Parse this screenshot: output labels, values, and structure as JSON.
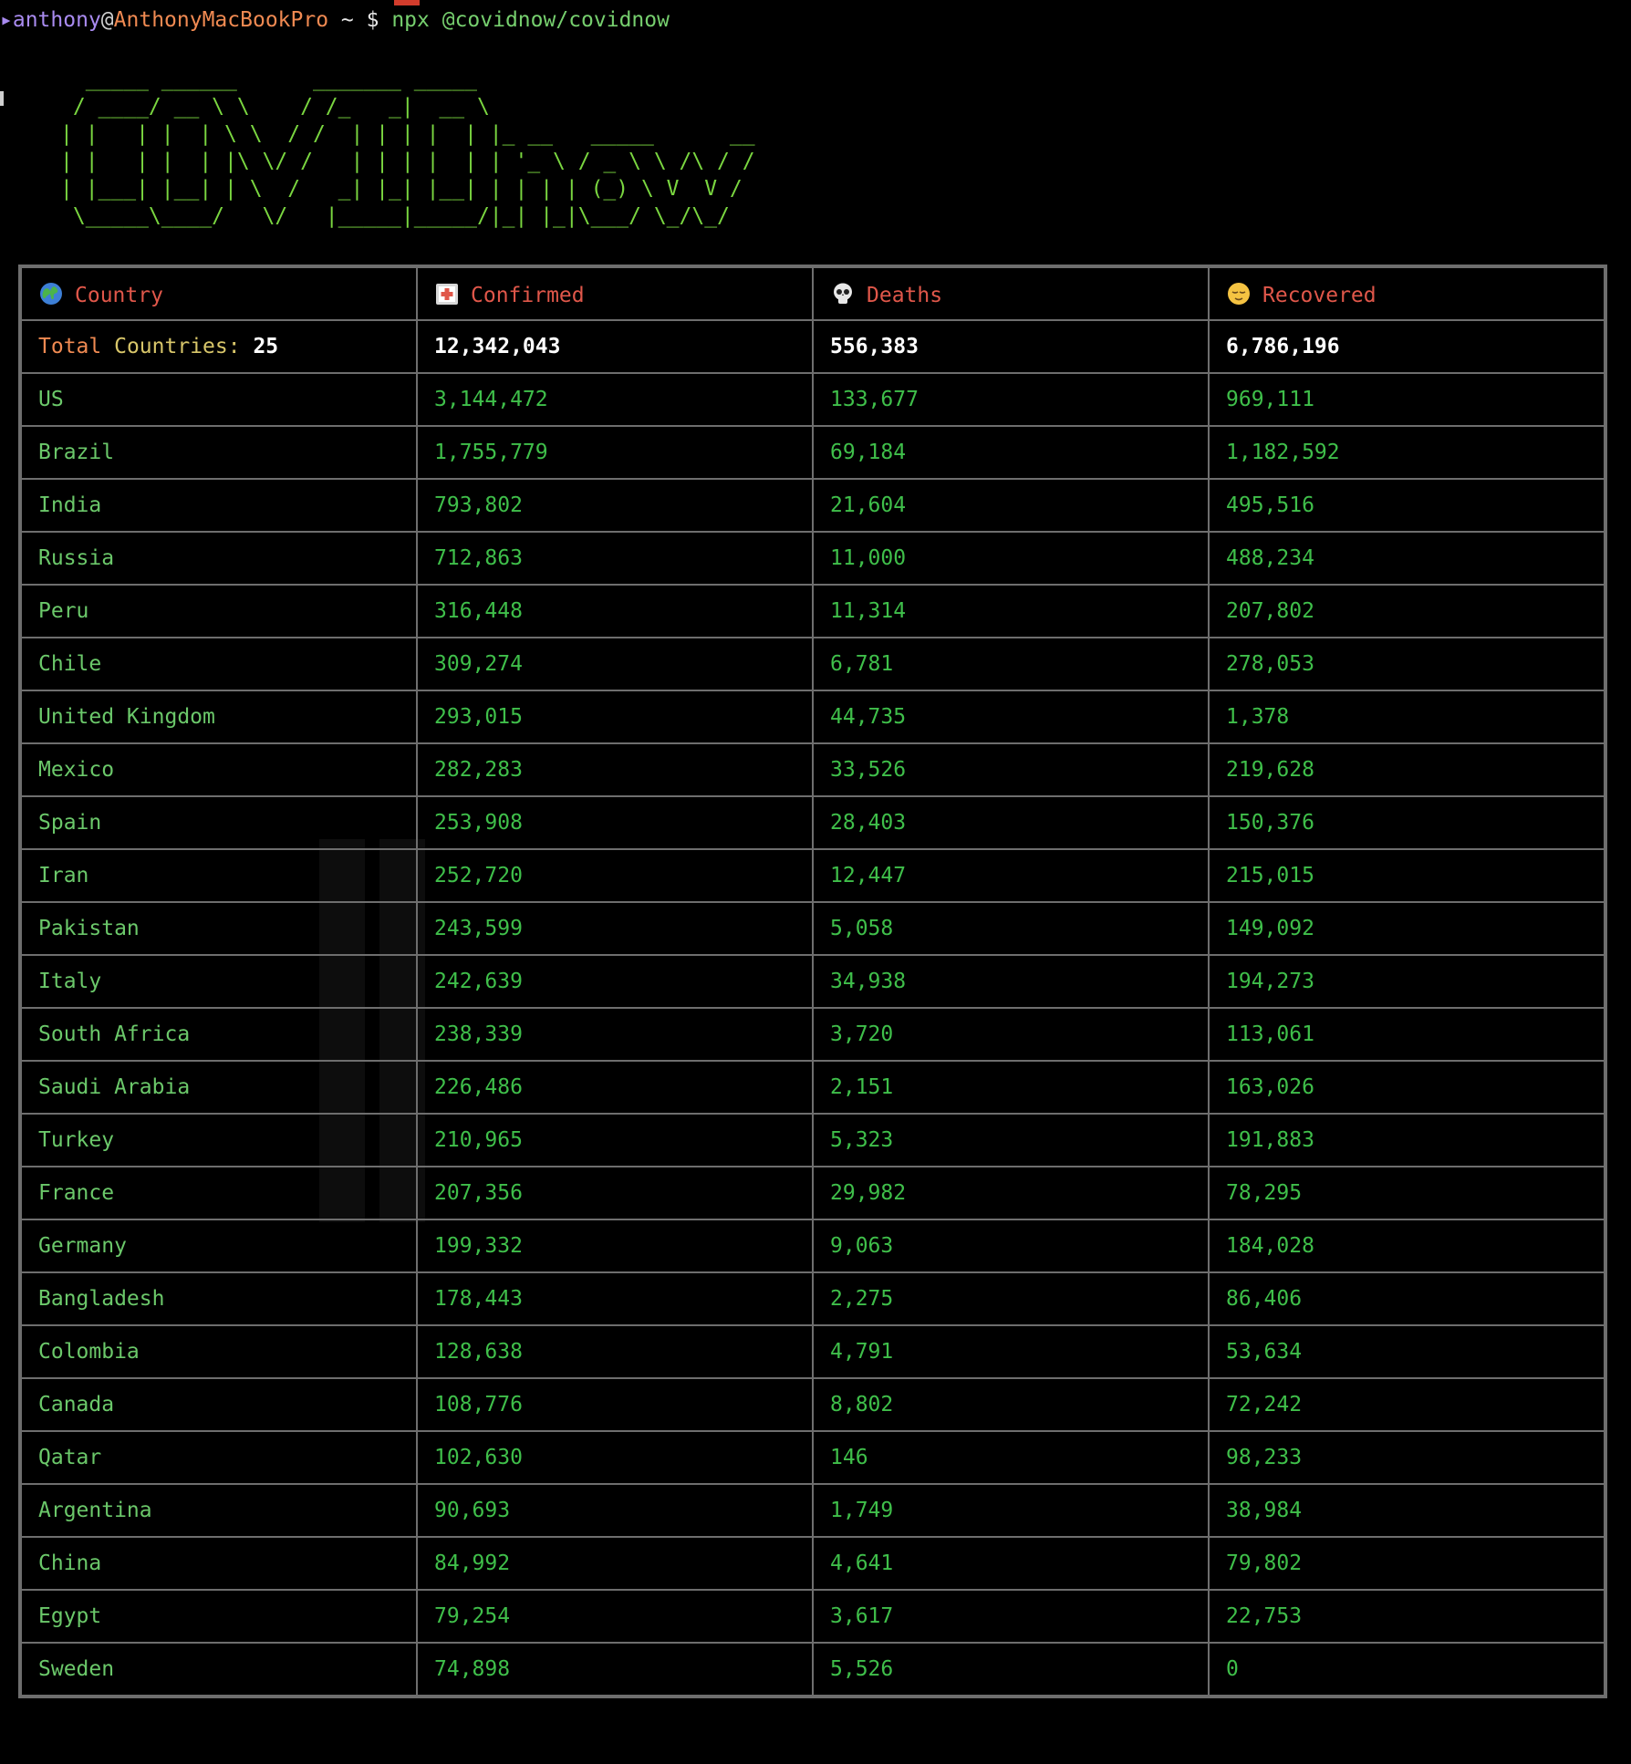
{
  "terminal": {
    "prompt": {
      "user": "anthony",
      "at": "@",
      "host": "AnthonyMacBookPro",
      "path": " ~ ",
      "dollar": "$",
      "command": "npx @covidnow/covidnow"
    },
    "banner_art": "  _____ ______      _______ _____  \n / ____/ __ \\ \\    / /_   _|  __ \\ \n| |   | |  | \\ \\  / /  | | | |  | |_ __   _____      __\n| |   | |  | |\\ \\/ /   | | | |  | | '_ \\ / _ \\ \\ /\\ / /\n| |___| |__| | \\  /   _| |_| |__| | | | | (_) \\ V  V / \n \\_____\\____/   \\/   |_____|_____/|_| |_|\\___/ \\_/\\_/  "
  },
  "table": {
    "headers": [
      {
        "label": "Country",
        "icon": "globe-icon"
      },
      {
        "label": "Confirmed",
        "icon": "hospital-icon"
      },
      {
        "label": "Deaths",
        "icon": "skull-icon"
      },
      {
        "label": "Recovered",
        "icon": "relieved-face-icon"
      }
    ],
    "total": {
      "label_part1": "Total",
      "label_part2": "Countries:",
      "count": "25",
      "confirmed": "12,342,043",
      "deaths": "556,383",
      "recovered": "6,786,196"
    },
    "rows": [
      {
        "country": "US",
        "confirmed": "3,144,472",
        "deaths": "133,677",
        "recovered": "969,111"
      },
      {
        "country": "Brazil",
        "confirmed": "1,755,779",
        "deaths": "69,184",
        "recovered": "1,182,592"
      },
      {
        "country": "India",
        "confirmed": "793,802",
        "deaths": "21,604",
        "recovered": "495,516"
      },
      {
        "country": "Russia",
        "confirmed": "712,863",
        "deaths": "11,000",
        "recovered": "488,234"
      },
      {
        "country": "Peru",
        "confirmed": "316,448",
        "deaths": "11,314",
        "recovered": "207,802"
      },
      {
        "country": "Chile",
        "confirmed": "309,274",
        "deaths": "6,781",
        "recovered": "278,053"
      },
      {
        "country": "United Kingdom",
        "confirmed": "293,015",
        "deaths": "44,735",
        "recovered": "1,378"
      },
      {
        "country": "Mexico",
        "confirmed": "282,283",
        "deaths": "33,526",
        "recovered": "219,628"
      },
      {
        "country": "Spain",
        "confirmed": "253,908",
        "deaths": "28,403",
        "recovered": "150,376"
      },
      {
        "country": "Iran",
        "confirmed": "252,720",
        "deaths": "12,447",
        "recovered": "215,015"
      },
      {
        "country": "Pakistan",
        "confirmed": "243,599",
        "deaths": "5,058",
        "recovered": "149,092"
      },
      {
        "country": "Italy",
        "confirmed": "242,639",
        "deaths": "34,938",
        "recovered": "194,273"
      },
      {
        "country": "South Africa",
        "confirmed": "238,339",
        "deaths": "3,720",
        "recovered": "113,061"
      },
      {
        "country": "Saudi Arabia",
        "confirmed": "226,486",
        "deaths": "2,151",
        "recovered": "163,026"
      },
      {
        "country": "Turkey",
        "confirmed": "210,965",
        "deaths": "5,323",
        "recovered": "191,883"
      },
      {
        "country": "France",
        "confirmed": "207,356",
        "deaths": "29,982",
        "recovered": "78,295"
      },
      {
        "country": "Germany",
        "confirmed": "199,332",
        "deaths": "9,063",
        "recovered": "184,028"
      },
      {
        "country": "Bangladesh",
        "confirmed": "178,443",
        "deaths": "2,275",
        "recovered": "86,406"
      },
      {
        "country": "Colombia",
        "confirmed": "128,638",
        "deaths": "4,791",
        "recovered": "53,634"
      },
      {
        "country": "Canada",
        "confirmed": "108,776",
        "deaths": "8,802",
        "recovered": "72,242"
      },
      {
        "country": "Qatar",
        "confirmed": "102,630",
        "deaths": "146",
        "recovered": "98,233"
      },
      {
        "country": "Argentina",
        "confirmed": "90,693",
        "deaths": "1,749",
        "recovered": "38,984"
      },
      {
        "country": "China",
        "confirmed": "84,992",
        "deaths": "4,641",
        "recovered": "79,802"
      },
      {
        "country": "Egypt",
        "confirmed": "79,254",
        "deaths": "3,617",
        "recovered": "22,753"
      },
      {
        "country": "Sweden",
        "confirmed": "74,898",
        "deaths": "5,526",
        "recovered": "0"
      }
    ]
  },
  "colors": {
    "background": "#000000",
    "header_text": "#e0574a",
    "row_text": "#3fbf4a",
    "border": "#6e6e6e",
    "banner": "#7ad640"
  }
}
